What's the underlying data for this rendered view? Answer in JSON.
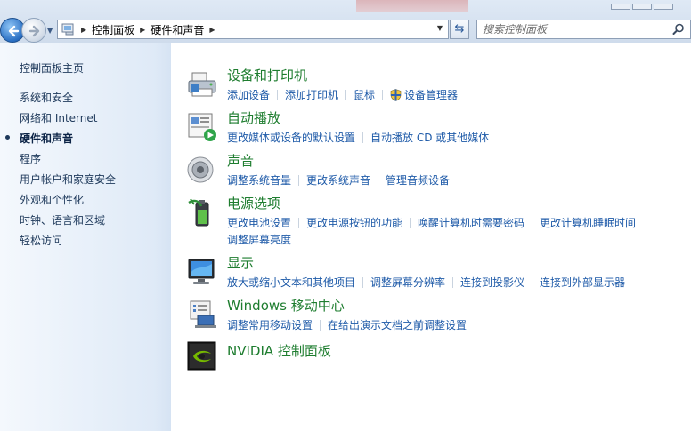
{
  "address": {
    "crumbs": [
      "控制面板",
      "硬件和声音"
    ]
  },
  "search": {
    "placeholder": "搜索控制面板"
  },
  "sidebar": {
    "home": "控制面板主页",
    "items": [
      {
        "label": "系统和安全"
      },
      {
        "label": "网络和 Internet"
      },
      {
        "label": "硬件和声音",
        "current": true
      },
      {
        "label": "程序"
      },
      {
        "label": "用户帐户和家庭安全"
      },
      {
        "label": "外观和个性化"
      },
      {
        "label": "时钟、语言和区域"
      },
      {
        "label": "轻松访问"
      }
    ]
  },
  "categories": [
    {
      "title": "设备和打印机",
      "icon": "printer-icon",
      "links": [
        "添加设备",
        "添加打印机",
        "鼠标",
        "设备管理器"
      ]
    },
    {
      "title": "自动播放",
      "icon": "autoplay-icon",
      "links": [
        "更改媒体或设备的默认设置",
        "自动播放 CD 或其他媒体"
      ]
    },
    {
      "title": "声音",
      "icon": "speaker-icon",
      "links": [
        "调整系统音量",
        "更改系统声音",
        "管理音频设备"
      ]
    },
    {
      "title": "电源选项",
      "icon": "battery-icon",
      "links": [
        "更改电池设置",
        "更改电源按钮的功能",
        "唤醒计算机时需要密码",
        "更改计算机睡眠时间"
      ],
      "links2": [
        "调整屏幕亮度"
      ]
    },
    {
      "title": "显示",
      "icon": "monitor-icon",
      "links": [
        "放大或缩小文本和其他项目",
        "调整屏幕分辨率",
        "连接到投影仪",
        "连接到外部显示器"
      ]
    },
    {
      "title": "Windows 移动中心",
      "icon": "mobility-center-icon",
      "links": [
        "调整常用移动设置",
        "在给出演示文档之前调整设置"
      ]
    },
    {
      "title": "NVIDIA 控制面板",
      "icon": "nvidia-icon",
      "links": []
    }
  ],
  "colors": {
    "title_green": "#1e7d2f",
    "link_blue": "#1e5aa8",
    "nav_text": "#1e395b"
  }
}
